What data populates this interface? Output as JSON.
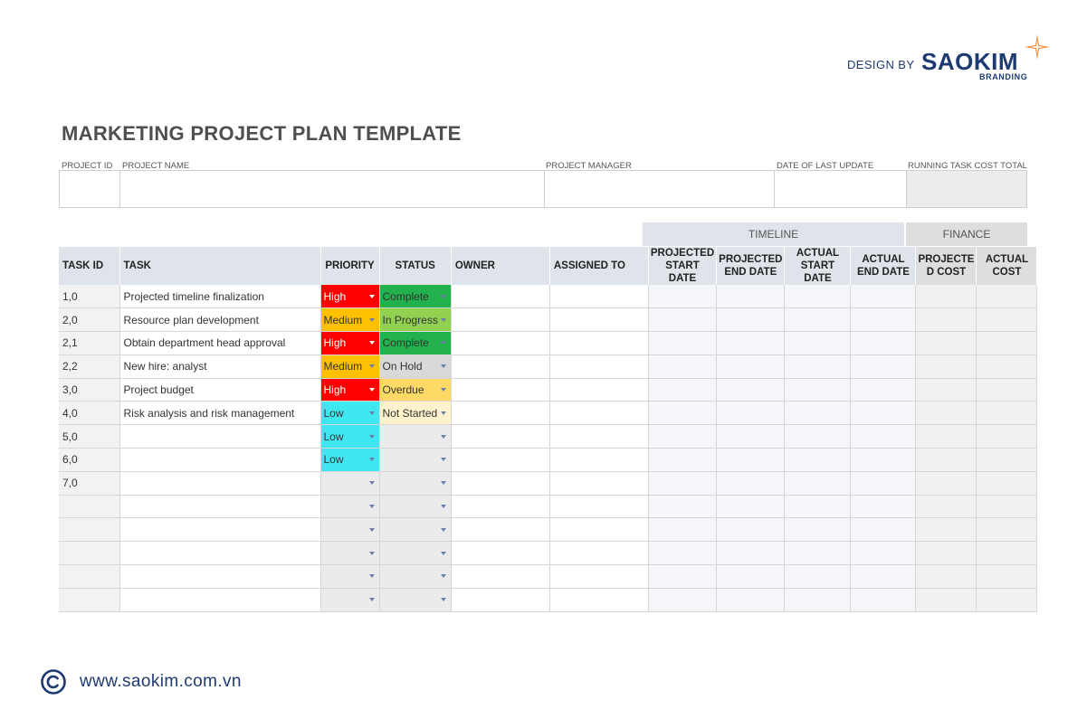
{
  "brand": {
    "design_by": "DESIGN BY",
    "name": "SAOKIM",
    "sub": "BRANDING",
    "color": "#1e3a72",
    "star_color": "#f08a3c"
  },
  "title": "MARKETING PROJECT PLAN TEMPLATE",
  "info_fields": {
    "project_id": "PROJECT ID",
    "project_name": "PROJECT NAME",
    "project_manager": "PROJECT MANAGER",
    "date_last_update": "DATE OF LAST UPDATE",
    "running_cost_total": "RUNNING TASK COST TOTAL"
  },
  "groups": {
    "timeline": "TIMELINE",
    "finance": "FINANCE"
  },
  "columns": {
    "task_id": "TASK ID",
    "task": "TASK",
    "priority": "PRIORITY",
    "status": "STATUS",
    "owner": "OWNER",
    "assigned_to": "ASSIGNED TO",
    "proj_start": "PROJECTED START DATE",
    "proj_end": "PROJECTED END DATE",
    "act_start": "ACTUAL START DATE",
    "act_end": "ACTUAL END DATE",
    "proj_cost": "PROJECTE D COST",
    "actual_cost": "ACTUAL COST"
  },
  "priority_colors": {
    "High": "#ff0000",
    "Medium": "#ffc000",
    "Low": "#3fe8f0",
    "": "#ebebeb"
  },
  "status_colors": {
    "Complete": "#22b14c",
    "In Progress": "#92d050",
    "On Hold": "#d9d9d9",
    "Overdue": "#ffd966",
    "Not Started": "#fff2cc",
    "": "#ebebeb"
  },
  "rows": [
    {
      "id": "1,0",
      "task": "Projected timeline finalization",
      "priority": "High",
      "status": "Complete"
    },
    {
      "id": "2,0",
      "task": "Resource plan development",
      "priority": "Medium",
      "status": "In Progress"
    },
    {
      "id": "2,1",
      "task": "Obtain department head approval",
      "priority": "High",
      "status": "Complete"
    },
    {
      "id": "2,2",
      "task": "New hire: analyst",
      "priority": "Medium",
      "status": "On Hold"
    },
    {
      "id": "3,0",
      "task": "Project budget",
      "priority": "High",
      "status": "Overdue"
    },
    {
      "id": "4,0",
      "task": "Risk analysis and risk management",
      "priority": "Low",
      "status": "Not Started"
    },
    {
      "id": "5,0",
      "task": "",
      "priority": "Low",
      "status": ""
    },
    {
      "id": "6,0",
      "task": "",
      "priority": "Low",
      "status": ""
    },
    {
      "id": "7,0",
      "task": "",
      "priority": "",
      "status": ""
    },
    {
      "id": "",
      "task": "",
      "priority": "",
      "status": ""
    },
    {
      "id": "",
      "task": "",
      "priority": "",
      "status": ""
    },
    {
      "id": "",
      "task": "",
      "priority": "",
      "status": ""
    },
    {
      "id": "",
      "task": "",
      "priority": "",
      "status": ""
    },
    {
      "id": "",
      "task": "",
      "priority": "",
      "status": ""
    }
  ],
  "footer": {
    "url": "www.saokim.com.vn",
    "icon": "copyright-icon"
  }
}
